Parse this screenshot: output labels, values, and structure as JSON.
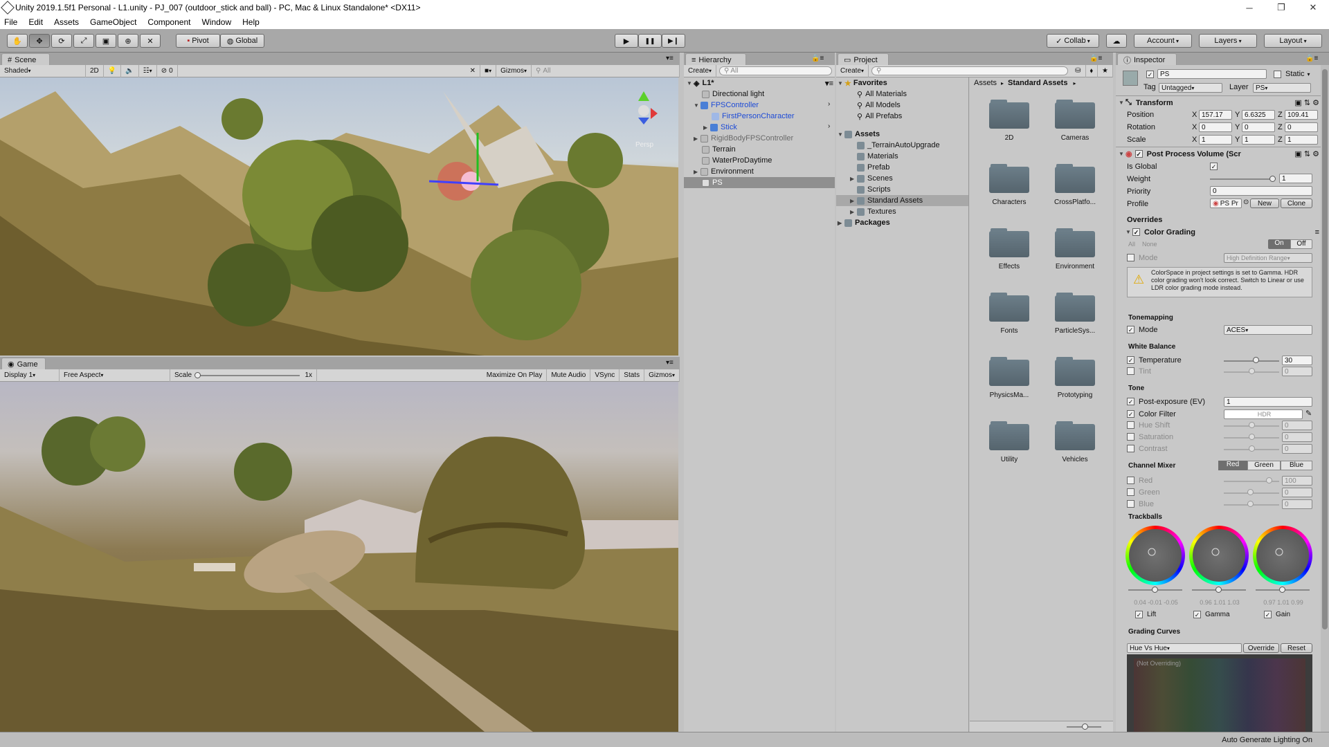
{
  "window": {
    "title": "Unity 2019.1.5f1 Personal - L1.unity - PJ_007 (outdoor_stick and  ball) - PC, Mac & Linux Standalone* <DX11>",
    "min": "─",
    "max": "❐",
    "close": "✕"
  },
  "menu": [
    "File",
    "Edit",
    "Assets",
    "GameObject",
    "Component",
    "Window",
    "Help"
  ],
  "toolbar": {
    "tools": [
      "hand-icon",
      "move-icon",
      "rotate-icon",
      "scale-icon",
      "rect-icon",
      "transform-icon",
      "custom-icon"
    ],
    "pivot": "Pivot",
    "global": "Global",
    "play": "▶",
    "pause": "❚❚",
    "step": "▶❙",
    "collab": "Collab",
    "account": "Account",
    "layers": "Layers",
    "layout": "Layout"
  },
  "scene": {
    "tab": "Scene",
    "shading": "Shaded",
    "mode2d": "2D",
    "gizmos": "Gizmos",
    "search": "All",
    "persp": "Persp",
    "effects_count": "0"
  },
  "game": {
    "tab": "Game",
    "display": "Display 1",
    "aspect": "Free Aspect",
    "scale_label": "Scale",
    "scale_value": "1x",
    "maximize": "Maximize On Play",
    "mute": "Mute Audio",
    "vsync": "VSync",
    "stats": "Stats",
    "gizmos": "Gizmos"
  },
  "hierarchy": {
    "tab": "Hierarchy",
    "create": "Create",
    "search": "All",
    "scene": "L1*",
    "items": [
      {
        "label": "Directional light",
        "style": ""
      },
      {
        "label": "FPSController",
        "style": "blue"
      },
      {
        "label": "FirstPersonCharacter",
        "style": "blue"
      },
      {
        "label": "Stick",
        "style": "blue"
      },
      {
        "label": "RigidBodyFPSController",
        "style": "gray"
      },
      {
        "label": "Terrain",
        "style": ""
      },
      {
        "label": "WaterProDaytime",
        "style": ""
      },
      {
        "label": "Environment",
        "style": ""
      },
      {
        "label": "PS",
        "style": "sel"
      }
    ]
  },
  "project": {
    "tab": "Project",
    "create": "Create",
    "favorites": "Favorites",
    "fav_items": [
      "All Materials",
      "All Models",
      "All Prefabs"
    ],
    "assets": "Assets",
    "asset_items": [
      "_TerrainAutoUpgrade",
      "Materials",
      "Prefab",
      "Scenes",
      "Scripts",
      "Standard Assets",
      "Textures"
    ],
    "packages": "Packages",
    "breadcrumb_root": "Assets",
    "breadcrumb_sep": "▸",
    "breadcrumb_current": "Standard Assets",
    "folders": [
      "2D",
      "Cameras",
      "Characters",
      "CrossPlatfo...",
      "Effects",
      "Environment",
      "Fonts",
      "ParticleSys...",
      "PhysicsMa...",
      "Prototyping",
      "Utility",
      "Vehicles"
    ]
  },
  "inspector": {
    "tab": "Inspector",
    "name": "PS",
    "static": "Static",
    "tag_label": "Tag",
    "tag": "Untagged",
    "layer_label": "Layer",
    "layer": "PS",
    "transform": "Transform",
    "position_label": "Position",
    "position": [
      "157.17",
      "6.6325",
      "109.41"
    ],
    "rotation_label": "Rotation",
    "rotation": [
      "0",
      "0",
      "0"
    ],
    "scale_label": "Scale",
    "scale": [
      "1",
      "1",
      "1"
    ],
    "axes": [
      "X",
      "Y",
      "Z"
    ],
    "ppv": "Post Process Volume (Scr",
    "is_global": "Is Global",
    "weight_label": "Weight",
    "weight": "1",
    "weight_fraction": 1,
    "priority_label": "Priority",
    "priority": "0",
    "profile_label": "Profile",
    "profile": "PS Pr",
    "new": "New",
    "clone": "Clone",
    "overrides": "Overrides",
    "color_grading": "Color Grading",
    "all": "All",
    "none": "None",
    "on": "On",
    "off": "Off",
    "mode_label": "Mode",
    "mode_value": "High Definition Range",
    "warning": "ColorSpace in project settings is set to Gamma. HDR color grading won't look correct. Switch to Linear or use LDR color grading mode instead.",
    "tonemapping": "Tonemapping",
    "tm_mode_label": "Mode",
    "tm_mode": "ACES",
    "white_balance": "White Balance",
    "temperature_label": "Temperature",
    "temperature": "30",
    "tint_label": "Tint",
    "tint": "0",
    "tone": "Tone",
    "post_exposure_label": "Post-exposure (EV)",
    "post_exposure": "1",
    "color_filter_label": "Color Filter",
    "color_filter": "HDR",
    "hue_shift_label": "Hue Shift",
    "hue_shift": "0",
    "saturation_label": "Saturation",
    "saturation": "0",
    "contrast_label": "Contrast",
    "contrast": "0",
    "channel_mixer": "Channel Mixer",
    "cm_red": "Red",
    "cm_green": "Green",
    "cm_blue": "Blue",
    "red_label": "Red",
    "red": "100",
    "green_label": "Green",
    "green": "0",
    "blue_label": "Blue",
    "blue": "0",
    "trackballs": "Trackballs",
    "lift_vals": "0.04 -0.01 -0.05",
    "gamma_vals": "0.96 1.01 1.03",
    "gain_vals": "0.97 1.01 0.99",
    "lift": "Lift",
    "gamma": "Gamma",
    "gain": "Gain",
    "grading_curves": "Grading Curves",
    "curve_mode": "Hue Vs Hue",
    "override": "Override",
    "reset": "Reset",
    "not_overriding": "(Not Overriding)"
  },
  "status": {
    "text": "Auto Generate Lighting On"
  }
}
